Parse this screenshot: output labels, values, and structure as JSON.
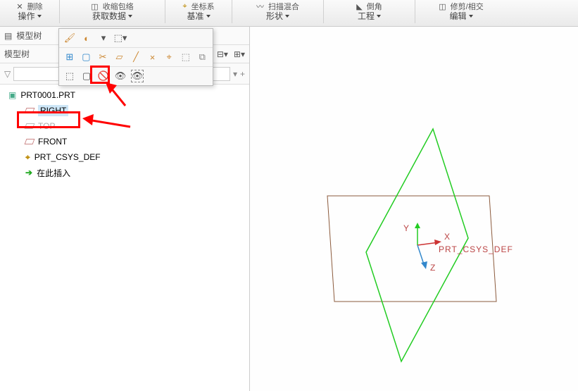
{
  "ribbon": {
    "groups": [
      {
        "label": "操作",
        "icon_hint": "删除"
      },
      {
        "label": "获取数据",
        "icon_hint": "收缩包络"
      },
      {
        "label": "基准",
        "icon_hint": "坐标系"
      },
      {
        "label": "形状",
        "icon_hint": "扫描混合"
      },
      {
        "label": "工程",
        "icon_hint": "倒角"
      },
      {
        "label": "编辑",
        "icon_hint": "修剪/相交"
      }
    ]
  },
  "sidebar": {
    "tree_label": "模型树",
    "sub_label": "模型树",
    "filter_placeholder": ""
  },
  "tree": {
    "root": "PRT0001.PRT",
    "items": [
      {
        "label": "RIGHT",
        "type": "plane",
        "state": "selected"
      },
      {
        "label": "TOP",
        "type": "plane",
        "state": "hidden"
      },
      {
        "label": "FRONT",
        "type": "plane",
        "state": "normal"
      },
      {
        "label": "PRT_CSYS_DEF",
        "type": "csys",
        "state": "normal"
      },
      {
        "label": "在此插入",
        "type": "insert",
        "state": "normal"
      }
    ]
  },
  "viewport": {
    "csys_label": "PRT_CSYS_DEF",
    "axes": {
      "x": "X",
      "y": "Y",
      "z": "Z"
    }
  },
  "popup": {
    "row2_icons": [
      "select-net",
      "box",
      "cut",
      "plane",
      "line",
      "point-x",
      "csys",
      "rect-dashed",
      "mirror"
    ],
    "row3_icons": [
      "toggle-vis",
      "show-box",
      "hide",
      "dashed-eye",
      "dashed-eye-sel"
    ]
  }
}
